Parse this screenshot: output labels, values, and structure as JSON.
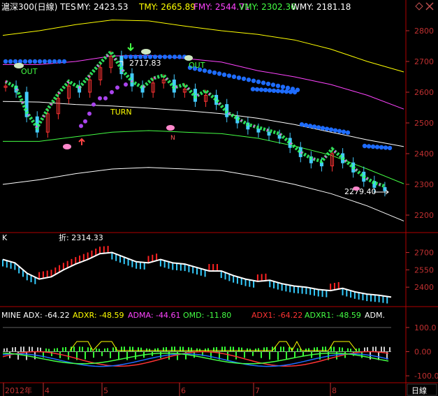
{
  "main_header": {
    "title": "滬深300(日線) TES",
    "items": [
      {
        "label": "MY: 2423.53",
        "color": "#ffffff"
      },
      {
        "label": "TMY: 2665.89",
        "color": "#ffff00"
      },
      {
        "label": "FMY: 2544.71",
        "color": "#ff44ff"
      },
      {
        "label": "VMY: 2302.36",
        "color": "#44ff44"
      },
      {
        "label": "WMY: 2181.18",
        "color": "#ffffff"
      }
    ]
  },
  "window_controls": {
    "diamond_icon": "diamond-icon",
    "close_icon": "close-icon"
  },
  "annotations": {
    "high_label": "2717.83",
    "low_label": "2279.40",
    "out_label_1": "OUT",
    "out_label_2": "OUT",
    "turn_label": "TURN",
    "n_label": "N",
    "sub_label": "折: 2314.33",
    "k_label": "K"
  },
  "main_axis": {
    "ticks": [
      "2800",
      "2700",
      "2600",
      "2500",
      "2400",
      "2300",
      "2200"
    ]
  },
  "k_axis": {
    "ticks": [
      "2700",
      "2550",
      "2400"
    ]
  },
  "mine_header": {
    "items": [
      {
        "label": "MINE ADX: -64.22",
        "color": "#ffffff"
      },
      {
        "label": "ADXR: -48.59",
        "color": "#ffff00"
      },
      {
        "label": "ADMA: -44.61",
        "color": "#ff44ff"
      },
      {
        "label": "OMD: -11.80",
        "color": "#44ff44"
      },
      {
        "label": "ADX1: -64.22",
        "color": "#ff3333"
      },
      {
        "label": "ADXR1: -48.59",
        "color": "#44ff44"
      },
      {
        "label": "ADM.",
        "color": "#ffffff"
      }
    ]
  },
  "mine_axis": {
    "ticks": [
      "100.0",
      "0.00",
      "-100.0"
    ]
  },
  "time_axis": {
    "labels": [
      "2012年",
      "4",
      "5",
      "6",
      "7",
      "8"
    ],
    "period_button": "日線"
  },
  "chart_data": [
    {
      "type": "candlestick",
      "title": "滬深300(日線) TES",
      "x": [
        "2012-03",
        "2012-04",
        "2012-05",
        "2012-06",
        "2012-07",
        "2012-08"
      ],
      "ylim": [
        2150,
        2850
      ],
      "series": [
        {
          "name": "MY",
          "last": 2423.53,
          "color": "#ffffff",
          "values": [
            2570,
            2568,
            2560,
            2555,
            2548,
            2540,
            2530,
            2515,
            2495,
            2470,
            2445,
            2423
          ]
        },
        {
          "name": "TMY",
          "last": 2665.89,
          "color": "#ffff00",
          "values": [
            2785,
            2800,
            2820,
            2835,
            2832,
            2815,
            2800,
            2788,
            2770,
            2740,
            2700,
            2666
          ]
        },
        {
          "name": "FMY",
          "last": 2544.71,
          "color": "#ff44ff",
          "values": [
            2690,
            2690,
            2700,
            2718,
            2720,
            2710,
            2698,
            2670,
            2650,
            2625,
            2590,
            2545
          ]
        },
        {
          "name": "VMY",
          "last": 2302.36,
          "color": "#44ff44",
          "values": [
            2440,
            2440,
            2455,
            2470,
            2475,
            2470,
            2465,
            2450,
            2425,
            2395,
            2350,
            2302
          ]
        },
        {
          "name": "WMY",
          "last": 2181.18,
          "color": "#ffffff",
          "values": [
            2300,
            2315,
            2335,
            2350,
            2355,
            2350,
            2345,
            2325,
            2300,
            2270,
            2230,
            2181
          ]
        }
      ],
      "price": [
        2620,
        2600,
        2520,
        2470,
        2530,
        2580,
        2620,
        2600,
        2640,
        2680,
        2717,
        2660,
        2620,
        2600,
        2630,
        2640,
        2600,
        2610,
        2570,
        2590,
        2560,
        2520,
        2500,
        2480,
        2470,
        2460,
        2450,
        2420,
        2390,
        2370,
        2360,
        2400,
        2370,
        2340,
        2310,
        2290,
        2279
      ],
      "high": 2717.83,
      "low": 2279.4,
      "annotations": [
        "OUT",
        "OUT",
        "TURN",
        "N"
      ]
    },
    {
      "type": "line",
      "title": "K",
      "ylim": [
        2250,
        2800
      ],
      "label": "折: 2314.33",
      "values": [
        2640,
        2610,
        2520,
        2470,
        2490,
        2550,
        2600,
        2640,
        2690,
        2700,
        2660,
        2620,
        2610,
        2640,
        2610,
        2600,
        2570,
        2540,
        2540,
        2500,
        2470,
        2450,
        2460,
        2430,
        2410,
        2400,
        2380,
        2370,
        2390,
        2360,
        2340,
        2330,
        2314
      ]
    },
    {
      "type": "line",
      "title": "MINE",
      "ylim": [
        -120,
        120
      ],
      "series": [
        {
          "name": "ADX",
          "last": -64.22,
          "color": "#ffffff"
        },
        {
          "name": "ADXR",
          "last": -48.59,
          "color": "#ffff00"
        },
        {
          "name": "ADMA",
          "last": -44.61,
          "color": "#ff44ff"
        },
        {
          "name": "OMD",
          "last": -11.8,
          "color": "#44ff44"
        },
        {
          "name": "ADX1",
          "last": -64.22,
          "color": "#ff3333"
        },
        {
          "name": "ADXR1",
          "last": -48.59,
          "color": "#44ff44"
        }
      ]
    }
  ]
}
